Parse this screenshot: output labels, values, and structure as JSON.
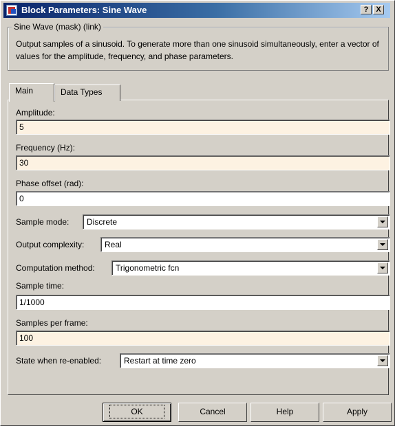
{
  "window": {
    "title": "Block Parameters: Sine Wave",
    "help_glyph": "?",
    "close_glyph": "X"
  },
  "group": {
    "legend": "Sine Wave (mask) (link)",
    "description": "Output samples of a sinusoid.  To generate more than one sinusoid simultaneously, enter a vector of values for the amplitude, frequency, and phase parameters."
  },
  "tabs": [
    {
      "label": "Main",
      "active": true
    },
    {
      "label": "Data Types",
      "active": false
    }
  ],
  "params": {
    "amplitude": {
      "label": "Amplitude:",
      "value": "5"
    },
    "frequency": {
      "label": "Frequency (Hz):",
      "value": "30"
    },
    "phase": {
      "label": "Phase offset (rad):",
      "value": "0"
    },
    "sample_mode": {
      "label": "Sample mode:",
      "value": "Discrete"
    },
    "output_complexity": {
      "label": "Output complexity:",
      "value": "Real"
    },
    "computation_method": {
      "label": "Computation method:",
      "value": "Trigonometric fcn"
    },
    "sample_time": {
      "label": "Sample time:",
      "value": "1/1000"
    },
    "samples_per_frame": {
      "label": "Samples per frame:",
      "value": "100"
    },
    "state_reenabled": {
      "label": "State when re-enabled:",
      "value": "Restart at time zero"
    }
  },
  "buttons": {
    "ok": "OK",
    "cancel": "Cancel",
    "help": "Help",
    "apply": "Apply"
  },
  "colors": {
    "dialog_bg": "#d4d0c8",
    "titlebar_start": "#0a246a",
    "titlebar_end": "#a6caf0",
    "editable_field_bg": "#fdf2e2"
  }
}
